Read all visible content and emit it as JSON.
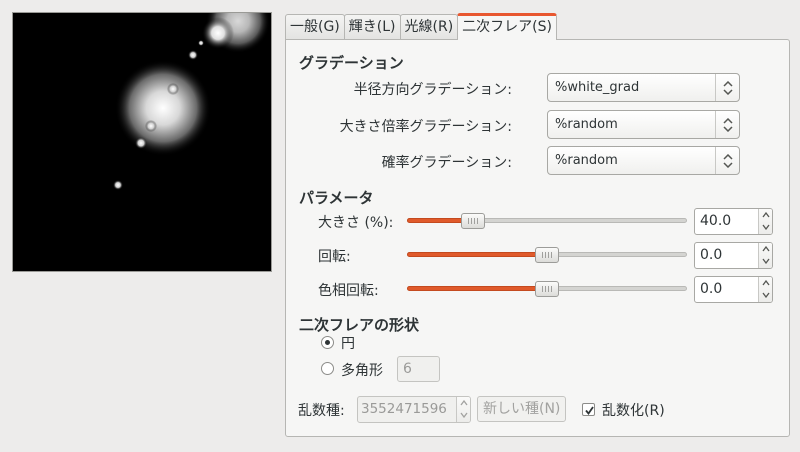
{
  "tabs": [
    {
      "label": "一般(G)",
      "active": false
    },
    {
      "label": "輝き(L)",
      "active": false
    },
    {
      "label": "光線(R)",
      "active": false
    },
    {
      "label": "二次フレア(S)",
      "active": true
    }
  ],
  "gradient_section": {
    "title": "グラデーション",
    "rows": [
      {
        "label": "半径方向グラデーション:",
        "value": "%white_grad"
      },
      {
        "label": "大きさ倍率グラデーション:",
        "value": "%random"
      },
      {
        "label": "確率グラデーション:",
        "value": "%random"
      }
    ]
  },
  "params_section": {
    "title": "パラメータ",
    "rows": [
      {
        "label": "大きさ (%):",
        "value": "40.0",
        "position": 0.21
      },
      {
        "label": "回転:",
        "value": "0.0",
        "position": 0.5
      },
      {
        "label": "色相回転:",
        "value": "0.0",
        "position": 0.5
      }
    ]
  },
  "shape_section": {
    "title": "二次フレアの形状",
    "circle_label": "円",
    "circle_checked": true,
    "polygon_label": "多角形",
    "polygon_checked": false,
    "polygon_sides": "6"
  },
  "random": {
    "seed_label": "乱数種:",
    "seed_value": "3552471596",
    "new_seed_label": "新しい種(N)",
    "randomize_label": "乱数化(R)",
    "randomize_checked": true
  },
  "colors": {
    "accent": "#e05a2b",
    "background": "#edeceb"
  }
}
